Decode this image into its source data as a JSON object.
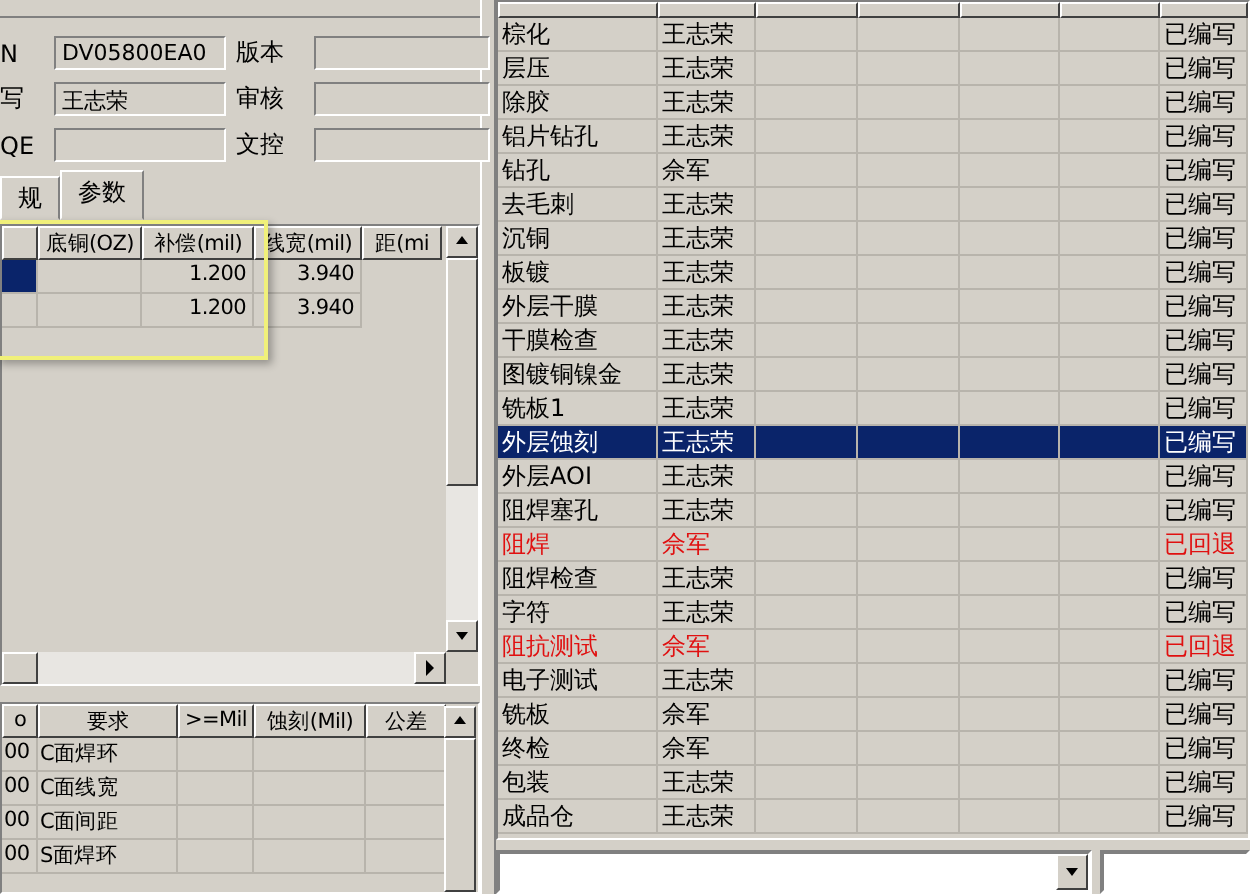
{
  "header_fields": [
    {
      "label": "N",
      "value": "DV05800EA0"
    },
    {
      "label": "版本"
    },
    {
      "label": "写",
      "value": "王志荣"
    },
    {
      "label": "审核"
    },
    {
      "label": "QE"
    },
    {
      "label": "文控"
    }
  ],
  "tabs": [
    {
      "label": "规",
      "selected": false
    },
    {
      "label": "参数",
      "selected": true
    }
  ],
  "param_table": {
    "columns": [
      "底铜(OZ)",
      "补偿(mil)",
      "线宽(mil)",
      "距(mi"
    ],
    "rows": [
      {
        "selected": true,
        "cells": [
          "",
          "1.200",
          "3.940"
        ]
      },
      {
        "selected": false,
        "cells": [
          "",
          "1.200",
          "3.940"
        ]
      }
    ]
  },
  "req_table": {
    "columns": [
      "o",
      "要求",
      ">=Mil",
      "蚀刻(Mil)",
      "公差"
    ],
    "rows": [
      [
        "00",
        "C面焊环"
      ],
      [
        "00",
        "C面线宽"
      ],
      [
        "00",
        "C面间距"
      ],
      [
        "00",
        "S面焊环"
      ]
    ]
  },
  "process_table": {
    "rows": [
      {
        "name": "棕化",
        "person": "王志荣",
        "status": "已编写",
        "selected": false,
        "rejected": false
      },
      {
        "name": "层压",
        "person": "王志荣",
        "status": "已编写",
        "selected": false,
        "rejected": false
      },
      {
        "name": "除胶",
        "person": "王志荣",
        "status": "已编写",
        "selected": false,
        "rejected": false
      },
      {
        "name": "铝片钻孔",
        "person": "王志荣",
        "status": "已编写",
        "selected": false,
        "rejected": false
      },
      {
        "name": "钻孔",
        "person": "佘军",
        "status": "已编写",
        "selected": false,
        "rejected": false
      },
      {
        "name": "去毛刺",
        "person": "王志荣",
        "status": "已编写",
        "selected": false,
        "rejected": false
      },
      {
        "name": "沉铜",
        "person": "王志荣",
        "status": "已编写",
        "selected": false,
        "rejected": false
      },
      {
        "name": "板镀",
        "person": "王志荣",
        "status": "已编写",
        "selected": false,
        "rejected": false
      },
      {
        "name": "外层干膜",
        "person": "王志荣",
        "status": "已编写",
        "selected": false,
        "rejected": false
      },
      {
        "name": "干膜检查",
        "person": "王志荣",
        "status": "已编写",
        "selected": false,
        "rejected": false
      },
      {
        "name": "图镀铜镍金",
        "person": "王志荣",
        "status": "已编写",
        "selected": false,
        "rejected": false
      },
      {
        "name": "铣板1",
        "person": "王志荣",
        "status": "已编写",
        "selected": false,
        "rejected": false
      },
      {
        "name": "外层蚀刻",
        "person": "王志荣",
        "status": "已编写",
        "selected": true,
        "rejected": false
      },
      {
        "name": "外层AOI",
        "person": "王志荣",
        "status": "已编写",
        "selected": false,
        "rejected": false
      },
      {
        "name": "阻焊塞孔",
        "person": "王志荣",
        "status": "已编写",
        "selected": false,
        "rejected": false
      },
      {
        "name": "阻焊",
        "person": "佘军",
        "status": "已回退",
        "selected": false,
        "rejected": true
      },
      {
        "name": "阻焊检查",
        "person": "王志荣",
        "status": "已编写",
        "selected": false,
        "rejected": false
      },
      {
        "name": "字符",
        "person": "王志荣",
        "status": "已编写",
        "selected": false,
        "rejected": false
      },
      {
        "name": "阻抗测试",
        "person": "佘军",
        "status": "已回退",
        "selected": false,
        "rejected": true
      },
      {
        "name": "电子测试",
        "person": "王志荣",
        "status": "已编写",
        "selected": false,
        "rejected": false
      },
      {
        "name": "铣板",
        "person": "佘军",
        "status": "已编写",
        "selected": false,
        "rejected": false
      },
      {
        "name": "终检",
        "person": "佘军",
        "status": "已编写",
        "selected": false,
        "rejected": false
      },
      {
        "name": "包装",
        "person": "王志荣",
        "status": "已编写",
        "selected": false,
        "rejected": false
      },
      {
        "name": "成品仓",
        "person": "王志荣",
        "status": "已编写",
        "selected": false,
        "rejected": false
      }
    ]
  }
}
